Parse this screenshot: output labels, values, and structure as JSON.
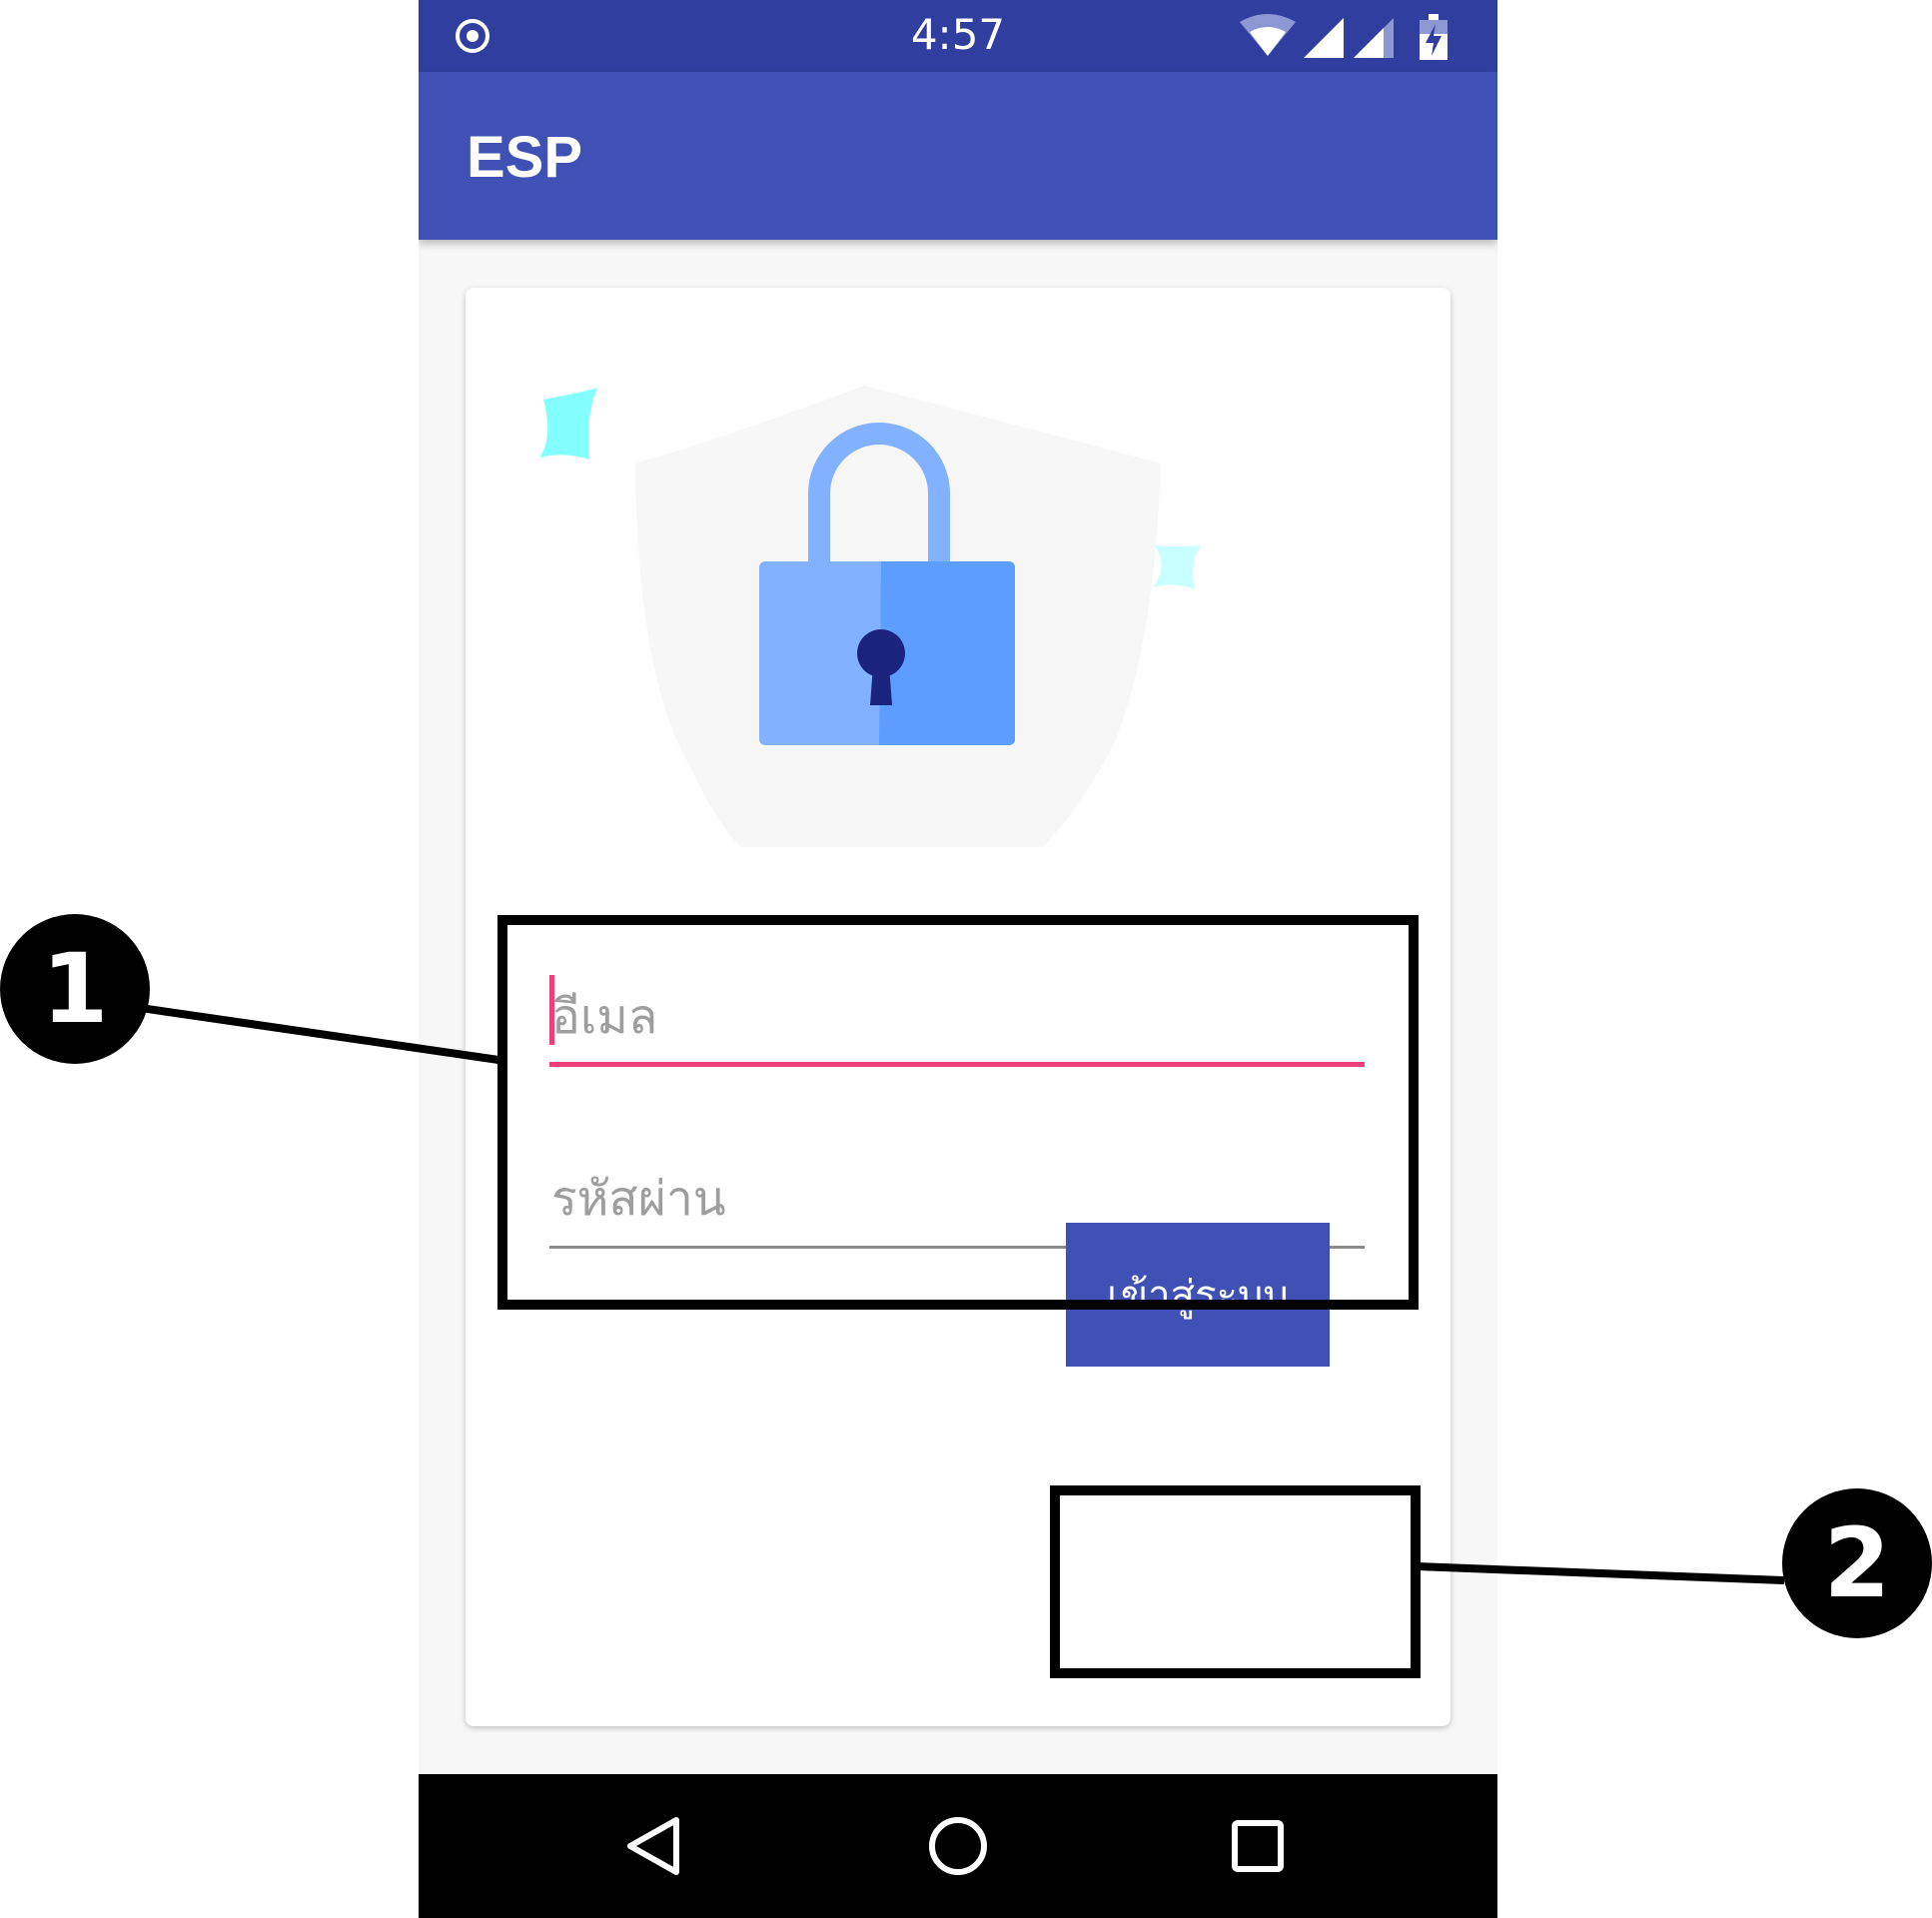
{
  "status_bar": {
    "time": "4:57",
    "icons": [
      "location-indicator-icon",
      "wifi-icon",
      "signal-icon",
      "signal-secondary-icon",
      "battery-charging-icon"
    ],
    "color": "#303f9f"
  },
  "app_bar": {
    "title": "ESP",
    "color": "#3f51b5"
  },
  "login_form": {
    "illustration": "lock-shield-icon",
    "email_placeholder": "อีเมล",
    "password_placeholder": "รหัสผ่าน",
    "login_button_label": "เข้าสู่ระบบ",
    "accent_color": "#ec407a"
  },
  "nav_bar": {
    "icons": [
      "back-icon",
      "home-icon",
      "recents-icon"
    ]
  },
  "annotations": {
    "callout_1": "1",
    "callout_2": "2"
  }
}
